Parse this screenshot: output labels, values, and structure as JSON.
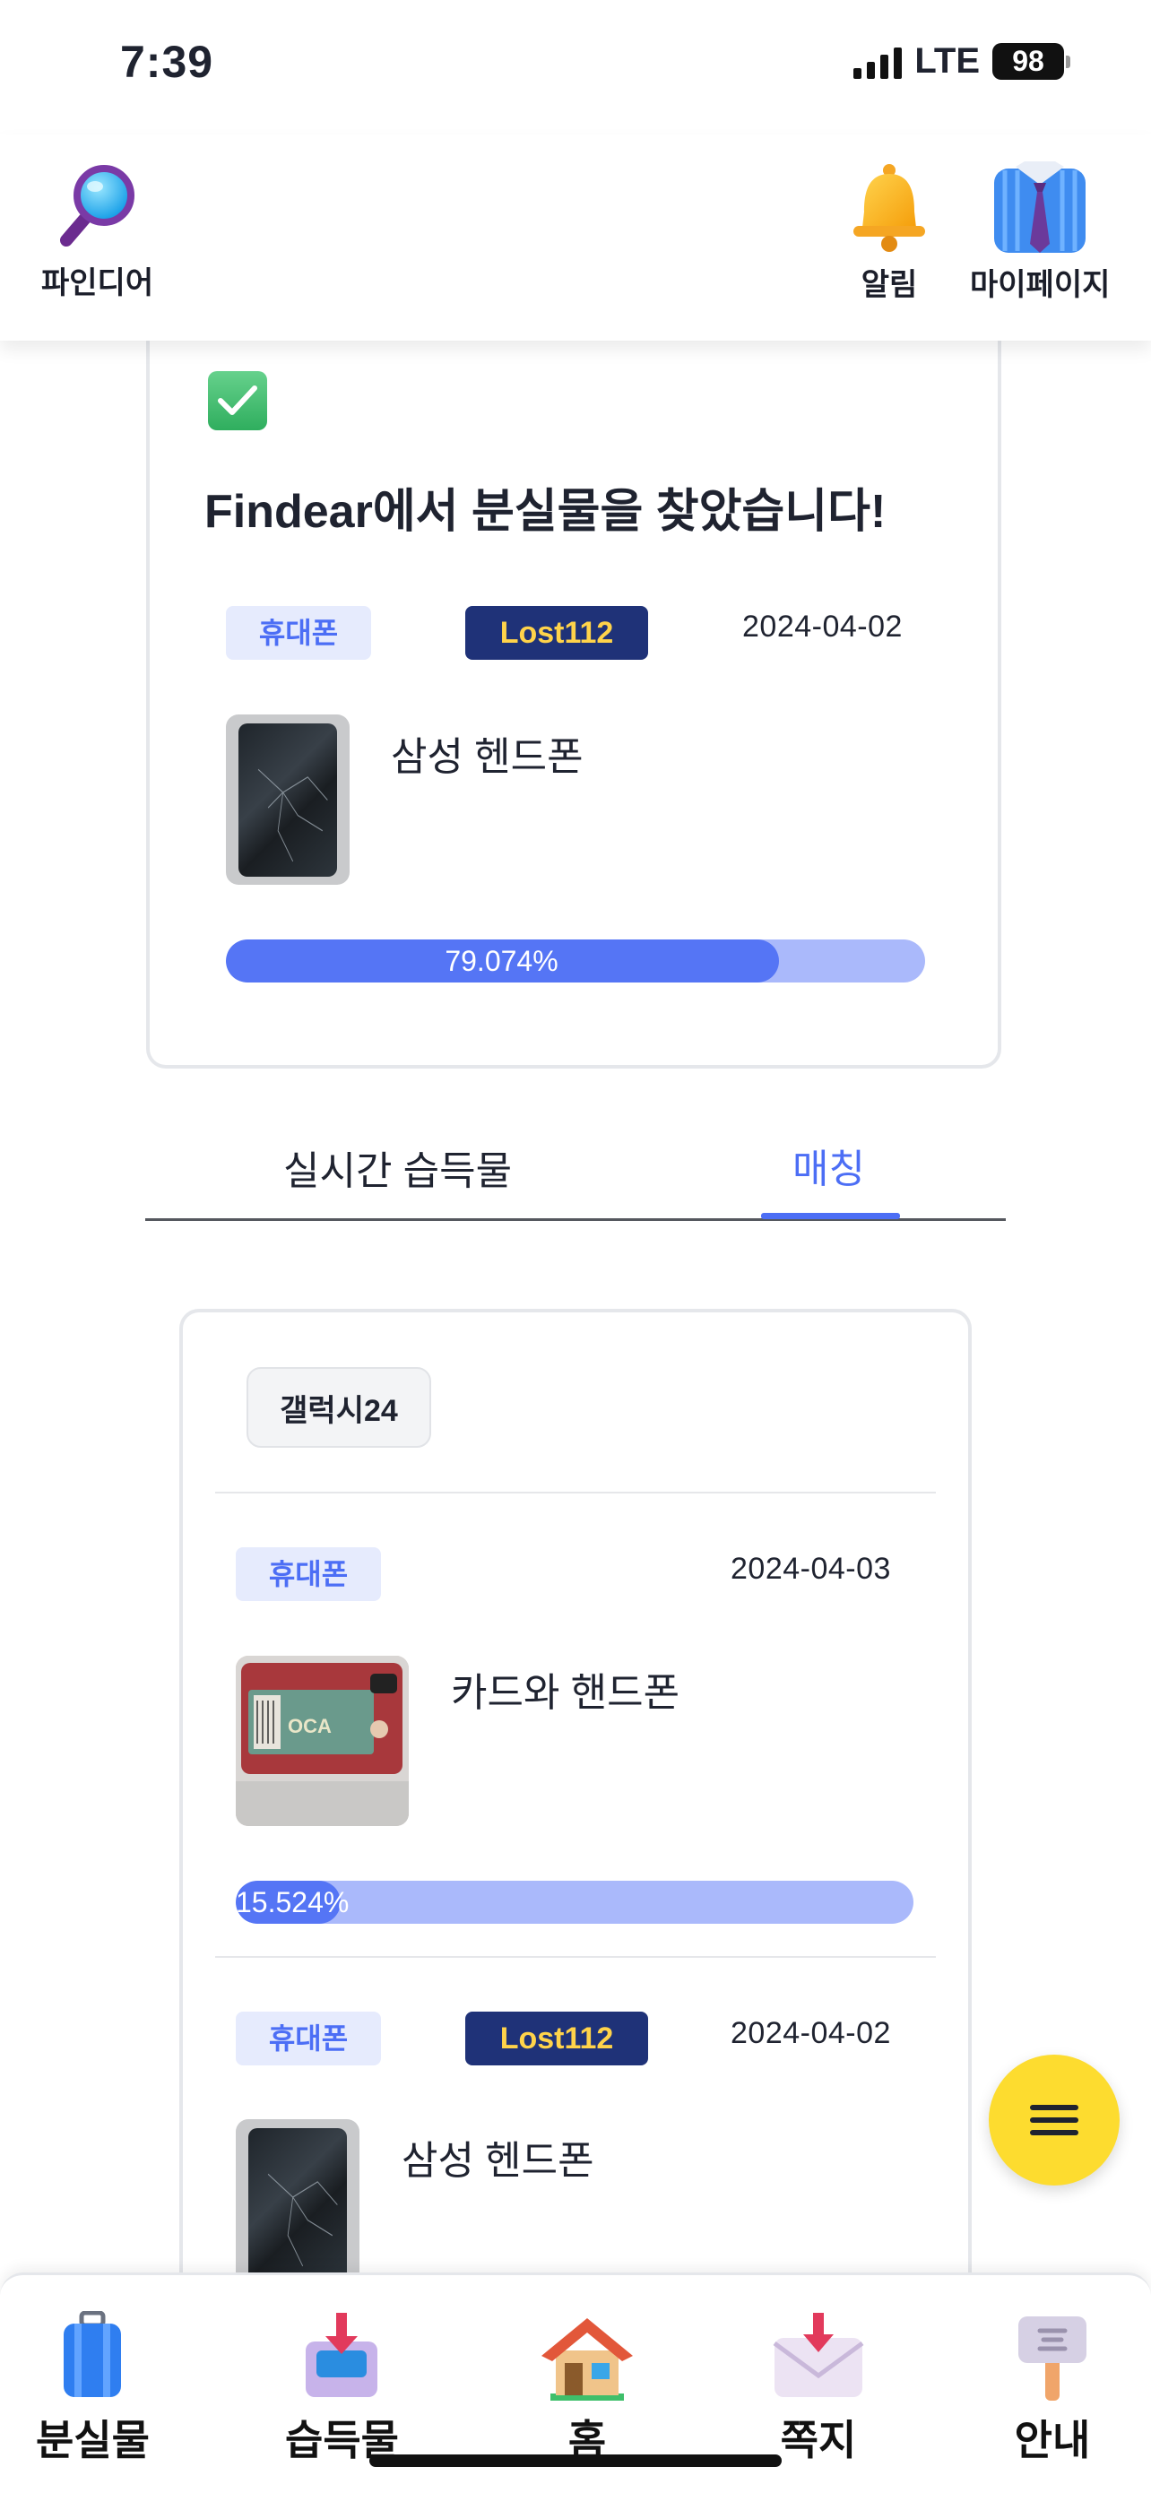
{
  "status_bar": {
    "time": "7:39",
    "network": "LTE",
    "battery": "98"
  },
  "header": {
    "logo_label": "파인디어",
    "alerts_label": "알림",
    "mypage_label": "마이페이지"
  },
  "found_card": {
    "title": "Findear에서 분실물을 찾았습니다!",
    "category": "휴대폰",
    "source": "Lost112",
    "date": "2024-04-02",
    "item_name": "삼성 헨드폰",
    "match_text": "79.074%",
    "match_value": 0.79074
  },
  "tabs": [
    {
      "label": "실시간 습득물",
      "active": false
    },
    {
      "label": "매칭",
      "active": true
    }
  ],
  "matching": {
    "keyword": "갤럭시24",
    "items": [
      {
        "category": "휴대폰",
        "date": "2024-04-03",
        "name": "카드와 핸드폰",
        "match_text": "15.524%",
        "match_value": 0.15524
      },
      {
        "category": "휴대폰",
        "source": "Lost112",
        "date": "2024-04-02",
        "name": "삼성 헨드폰"
      }
    ]
  },
  "fab": {
    "icon": "menu-icon"
  },
  "bottom_nav": [
    {
      "label": "분실물",
      "icon": "suitcase-icon"
    },
    {
      "label": "습득물",
      "icon": "inbox-download-icon"
    },
    {
      "label": "홈",
      "icon": "house-icon"
    },
    {
      "label": "쪽지",
      "icon": "envelope-icon"
    },
    {
      "label": "안내",
      "icon": "signpost-icon"
    }
  ],
  "colors": {
    "accent": "#4c6ef5",
    "badge_dark": "#1f3278",
    "badge_text": "#ffd34a",
    "fab": "#fddc2f",
    "bar_track": "#aab9fb"
  }
}
